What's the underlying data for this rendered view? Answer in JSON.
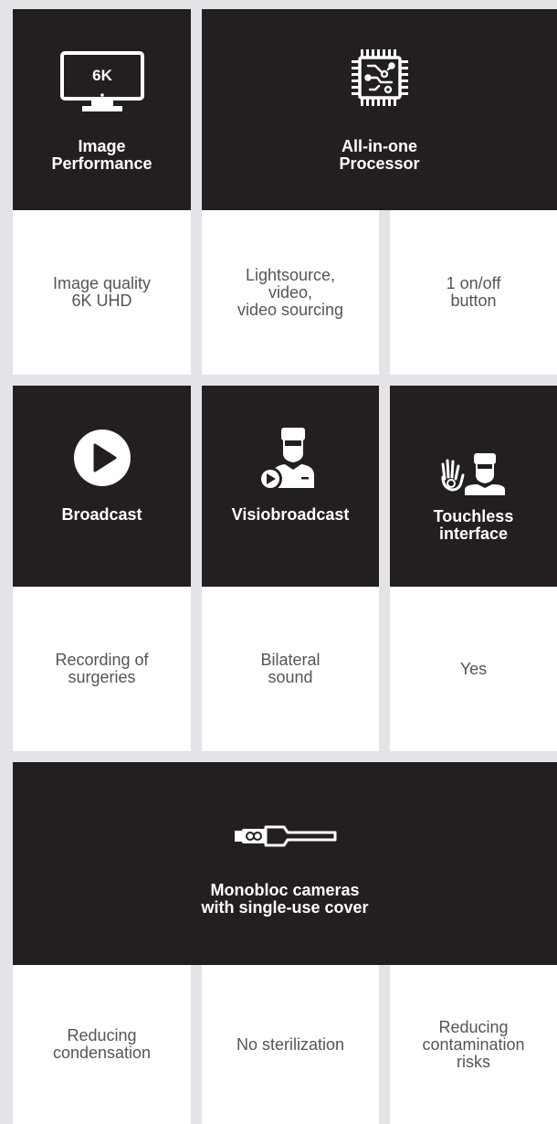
{
  "row1": {
    "image_performance": {
      "title": "Image\nPerformance",
      "monitor_text": "6K"
    },
    "processor": {
      "title": "All-in-one\nProcessor"
    },
    "values": [
      "Image quality\n6K UHD",
      "Lightsource,\nvideo,\nvideo sourcing",
      "1 on/off\nbutton"
    ]
  },
  "row2": {
    "broadcast": {
      "title": "Broadcast"
    },
    "visiobroadcast": {
      "title": "Visiobroadcast"
    },
    "touchless": {
      "title": "Touchless\ninterface"
    },
    "values": [
      "Recording of\nsurgeries",
      "Bilateral\nsound",
      "Yes"
    ]
  },
  "row3": {
    "monobloc": {
      "title": "Monobloc cameras\nwith single-use cover"
    },
    "values": [
      "Reducing\ncondensation",
      "No sterilization",
      "Reducing\ncontamination\nrisks"
    ]
  },
  "colors": {
    "dark": "#231f20",
    "light": "#ffffff",
    "gap": "#e3e3e8",
    "text": "#555555"
  }
}
